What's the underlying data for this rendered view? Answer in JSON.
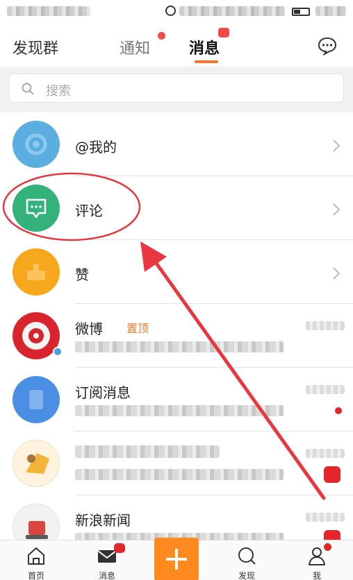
{
  "header": {
    "tabs": [
      {
        "label": "发现群"
      },
      {
        "label": "通知"
      },
      {
        "label": "消息"
      }
    ]
  },
  "search": {
    "placeholder": "搜索"
  },
  "list": {
    "items": [
      {
        "title": "@我的",
        "icon": "at-icon"
      },
      {
        "title": "评论",
        "icon": "comment-bubble-icon"
      },
      {
        "title": "赞",
        "icon": "thumb-up-icon"
      },
      {
        "title": "微博",
        "tag": "置顶",
        "icon": "weibo-avatar"
      },
      {
        "title": "订阅消息",
        "icon": "subscribe-avatar"
      },
      {
        "title": "",
        "icon": "user-avatar"
      },
      {
        "title": "新浪新闻",
        "icon": "news-avatar"
      }
    ]
  },
  "tabbar": {
    "items": [
      {
        "label": "首页",
        "icon": "home-icon"
      },
      {
        "label": "消息",
        "icon": "mail-icon"
      },
      {
        "label": "",
        "icon": "plus-icon"
      },
      {
        "label": "发现",
        "icon": "search-icon"
      },
      {
        "label": "我",
        "icon": "person-icon"
      }
    ]
  },
  "colors": {
    "accent": "#ff8a1f",
    "underline": "#ff6f24",
    "badge": "#e3262b",
    "annotation": "#e8373e",
    "comment_avatar": "#33b27b",
    "at_avatar": "#5aaee0",
    "like_avatar": "#f6a71c"
  }
}
